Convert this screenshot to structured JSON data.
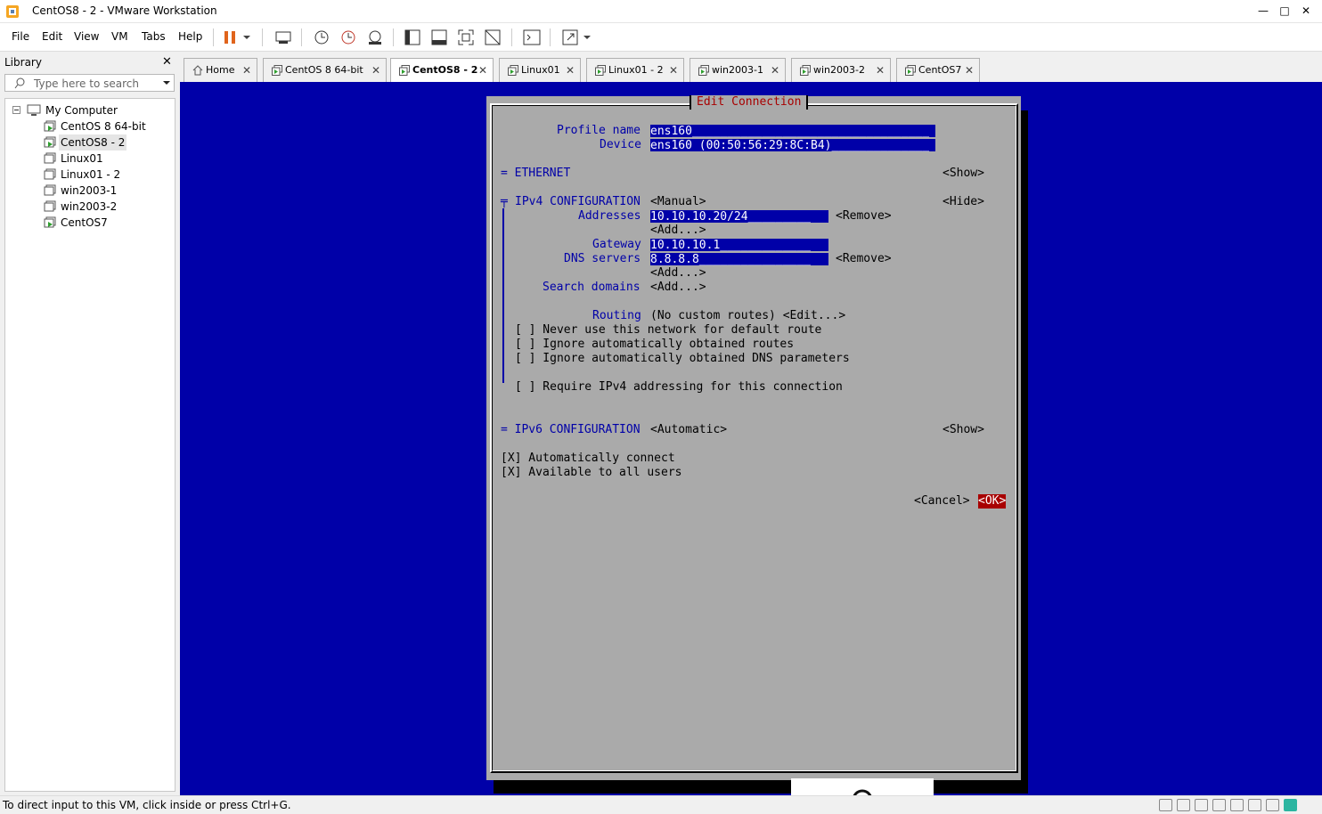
{
  "window": {
    "title": "CentOS8 - 2 - VMware Workstation",
    "controls": [
      "—",
      "□",
      "✕"
    ]
  },
  "menu": {
    "file": "File",
    "edit": "Edit",
    "view": "View",
    "vm": "VM",
    "tabs": "Tabs",
    "help": "Help"
  },
  "library": {
    "title": "Library",
    "close": "✕",
    "search_placeholder": "Type here to search",
    "root": "My Computer",
    "items": [
      {
        "label": "CentOS 8 64-bit",
        "running": true
      },
      {
        "label": "CentOS8 - 2",
        "running": true,
        "selected": true
      },
      {
        "label": "Linux01",
        "running": false
      },
      {
        "label": "Linux01 - 2",
        "running": false
      },
      {
        "label": "win2003-1",
        "running": false
      },
      {
        "label": "win2003-2",
        "running": false
      },
      {
        "label": "CentOS7",
        "running": true
      }
    ]
  },
  "tabs": [
    {
      "label": "Home",
      "close": "✕"
    },
    {
      "label": "CentOS 8 64-bit",
      "close": "✕"
    },
    {
      "label": "CentOS8 - 2",
      "close": "✕",
      "active": true
    },
    {
      "label": "Linux01",
      "close": "✕"
    },
    {
      "label": "Linux01 - 2",
      "close": "✕"
    },
    {
      "label": "win2003-1",
      "close": "✕"
    },
    {
      "label": "win2003-2",
      "close": "✕"
    },
    {
      "label": "CentOS7",
      "close": "✕"
    }
  ],
  "tui": {
    "title": "Edit Connection",
    "profile_name_label": "Profile name",
    "profile_name_value": "ens160__________________________________",
    "device_label": "Device",
    "device_value": "ens160 (00:50:56:29:8C:B4)______________",
    "ethernet_label": "= ETHERNET",
    "ethernet_toggle": "<Show>",
    "ipv4_marker": "╤",
    "ipv4_label": "IPv4 CONFIGURATION",
    "ipv4_mode": "<Manual>",
    "ipv4_toggle": "<Hide>",
    "addresses_label": "Addresses",
    "addresses_value": "10.10.10.20/24_________",
    "remove1": "<Remove>",
    "add1": "<Add...>",
    "gateway_label": "Gateway",
    "gateway_value": "10.10.10.1_____________",
    "dns_label": "DNS servers",
    "dns_value": "8.8.8.8________________",
    "remove2": "<Remove>",
    "add2": "<Add...>",
    "search_domains_label": "Search domains",
    "add3": "<Add...>",
    "routing_label": "Routing",
    "routing_value": "(No custom routes) <Edit...>",
    "opt1": "[ ] Never use this network for default route",
    "opt2": "[ ] Ignore automatically obtained routes",
    "opt3": "[ ] Ignore automatically obtained DNS parameters",
    "opt4": "[ ] Require IPv4 addressing for this connection",
    "ipv6_label": "= IPv6 CONFIGURATION",
    "ipv6_mode": "<Automatic>",
    "ipv6_toggle": "<Show>",
    "auto_connect": "[X] Automatically connect",
    "all_users": "[X] Available to all users",
    "cancel": "<Cancel>",
    "ok": "<OK>"
  },
  "status": {
    "message": "To direct input to this VM, click inside or press Ctrl+G."
  },
  "colors": {
    "vm_bg": "#0000a8",
    "dialog_bg": "#aaaaaa",
    "accent_red": "#a80000"
  }
}
